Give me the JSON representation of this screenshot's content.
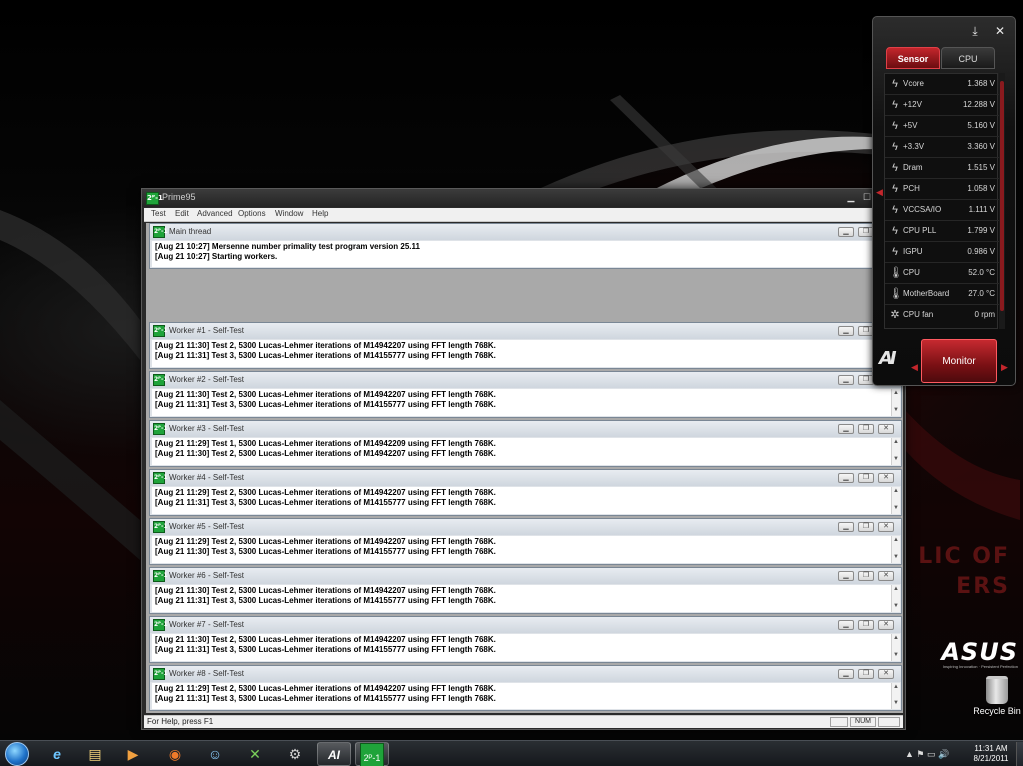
{
  "desktop": {
    "watermark_lines": [
      "LIC OF",
      "ERS"
    ],
    "brand": "ASUS",
    "brand_tagline": "Inspiring Innovation · Persistent Perfection",
    "recycle_bin_label": "Recycle Bin"
  },
  "prime95": {
    "title": "Prime95",
    "icon_text": "2ᴾ-1",
    "menu": [
      "Test",
      "Edit",
      "Advanced",
      "Options",
      "Window",
      "Help"
    ],
    "status_help": "For Help, press F1",
    "status_num": "NUM",
    "main_thread": {
      "title": "Main thread",
      "lines": [
        "[Aug 21 10:27] Mersenne number primality test program version 25.11",
        "[Aug 21 10:27] Starting workers."
      ]
    },
    "workers": [
      {
        "title": "Worker #1 - Self-Test",
        "lines": [
          "[Aug 21 11:30] Test 2, 5300 Lucas-Lehmer iterations of M14942207 using FFT length 768K.",
          "[Aug 21 11:31] Test 3, 5300 Lucas-Lehmer iterations of M14155777 using FFT length 768K."
        ]
      },
      {
        "title": "Worker #2 - Self-Test",
        "lines": [
          "[Aug 21 11:30] Test 2, 5300 Lucas-Lehmer iterations of M14942207 using FFT length 768K.",
          "[Aug 21 11:31] Test 3, 5300 Lucas-Lehmer iterations of M14155777 using FFT length 768K."
        ]
      },
      {
        "title": "Worker #3 - Self-Test",
        "lines": [
          "[Aug 21 11:29] Test 1, 5300 Lucas-Lehmer iterations of M14942209 using FFT length 768K.",
          "[Aug 21 11:30] Test 2, 5300 Lucas-Lehmer iterations of M14942207 using FFT length 768K."
        ]
      },
      {
        "title": "Worker #4 - Self-Test",
        "lines": [
          "[Aug 21 11:29] Test 2, 5300 Lucas-Lehmer iterations of M14942207 using FFT length 768K.",
          "[Aug 21 11:31] Test 3, 5300 Lucas-Lehmer iterations of M14155777 using FFT length 768K."
        ]
      },
      {
        "title": "Worker #5 - Self-Test",
        "lines": [
          "[Aug 21 11:29] Test 2, 5300 Lucas-Lehmer iterations of M14942207 using FFT length 768K.",
          "[Aug 21 11:30] Test 3, 5300 Lucas-Lehmer iterations of M14155777 using FFT length 768K."
        ]
      },
      {
        "title": "Worker #6 - Self-Test",
        "lines": [
          "[Aug 21 11:30] Test 2, 5300 Lucas-Lehmer iterations of M14942207 using FFT length 768K.",
          "[Aug 21 11:31] Test 3, 5300 Lucas-Lehmer iterations of M14155777 using FFT length 768K."
        ]
      },
      {
        "title": "Worker #7 - Self-Test",
        "lines": [
          "[Aug 21 11:30] Test 2, 5300 Lucas-Lehmer iterations of M14942207 using FFT length 768K.",
          "[Aug 21 11:31] Test 3, 5300 Lucas-Lehmer iterations of M14155777 using FFT length 768K."
        ]
      },
      {
        "title": "Worker #8 - Self-Test",
        "lines": [
          "[Aug 21 11:29] Test 2, 5300 Lucas-Lehmer iterations of M14942207 using FFT length 768K.",
          "[Aug 21 11:31] Test 3, 5300 Lucas-Lehmer iterations of M14155777 using FFT length 768K."
        ]
      }
    ]
  },
  "sensor_panel": {
    "tabs": [
      "Sensor",
      "CPU"
    ],
    "active_tab": "Sensor",
    "monitor_button": "Monitor",
    "logo": "AI",
    "sensors": [
      {
        "name": "Vcore",
        "value": "1.368",
        "unit": "V",
        "icon": "lightning-icon"
      },
      {
        "name": "+12V",
        "value": "12.288",
        "unit": "V",
        "icon": "lightning-icon"
      },
      {
        "name": "+5V",
        "value": "5.160",
        "unit": "V",
        "icon": "lightning-icon"
      },
      {
        "name": "+3.3V",
        "value": "3.360",
        "unit": "V",
        "icon": "lightning-icon"
      },
      {
        "name": "Dram",
        "value": "1.515",
        "unit": "V",
        "icon": "lightning-icon"
      },
      {
        "name": "PCH",
        "value": "1.058",
        "unit": "V",
        "icon": "lightning-icon"
      },
      {
        "name": "VCCSA/IO",
        "value": "1.111",
        "unit": "V",
        "icon": "lightning-icon"
      },
      {
        "name": "CPU PLL",
        "value": "1.799",
        "unit": "V",
        "icon": "lightning-icon"
      },
      {
        "name": "IGPU",
        "value": "0.986",
        "unit": "V",
        "icon": "lightning-icon"
      },
      {
        "name": "CPU",
        "value": "52.0",
        "unit": "°C",
        "icon": "thermometer-icon"
      },
      {
        "name": "MotherBoard",
        "value": "27.0",
        "unit": "°C",
        "icon": "thermometer-icon"
      },
      {
        "name": "CPU fan",
        "value": "0",
        "unit": "rpm",
        "icon": "fan-icon"
      }
    ]
  },
  "taskbar": {
    "items": [
      {
        "name": "internet-explorer",
        "glyph": "e"
      },
      {
        "name": "windows-explorer",
        "glyph": "▤"
      },
      {
        "name": "media-player",
        "glyph": "▶"
      },
      {
        "name": "firefox",
        "glyph": "◉"
      },
      {
        "name": "messenger",
        "glyph": "☺"
      },
      {
        "name": "xbox-app",
        "glyph": "✕"
      },
      {
        "name": "steam",
        "glyph": "⚙"
      },
      {
        "name": "ai-suite",
        "glyph": "AI"
      },
      {
        "name": "prime95",
        "glyph": "2ᴾ-1"
      }
    ],
    "tray_icons": "▲ ⚑ ▭ 🔊",
    "time": "11:31 AM",
    "date": "8/21/2011"
  },
  "colors": {
    "accent_red": "#c4262c",
    "prime_icon_green": "#1fa33a"
  }
}
